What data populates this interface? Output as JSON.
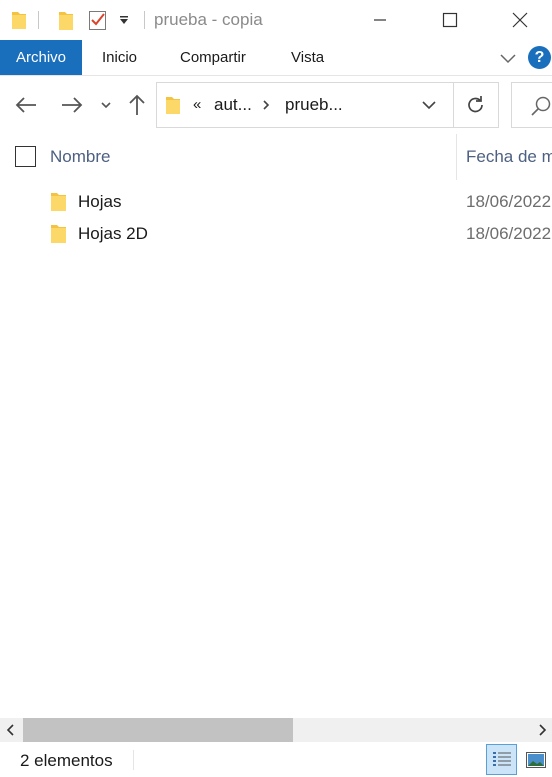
{
  "window": {
    "title": "prueba - copia",
    "accent": "#1a6fbd"
  },
  "quick_access": {
    "icons": [
      "folder-icon",
      "new-folder-icon",
      "properties-icon",
      "customize-dropdown-icon"
    ]
  },
  "window_controls": [
    "minimize-icon",
    "maximize-icon",
    "close-icon"
  ],
  "ribbon": {
    "tabs": [
      {
        "label": "Archivo",
        "active": true
      },
      {
        "label": "Inicio"
      },
      {
        "label": "Compartir"
      },
      {
        "label": "Vista"
      }
    ],
    "help_label": "?"
  },
  "navigation": {
    "buttons": [
      "back-arrow-icon",
      "forward-arrow-icon",
      "recent-locations-chevron-icon",
      "up-arrow-icon"
    ]
  },
  "address": {
    "overflow_marker": "«",
    "segments": [
      "aut...",
      "prueb..."
    ]
  },
  "columns": {
    "name": "Nombre",
    "date": "Fecha de m"
  },
  "files": [
    {
      "name": "Hojas",
      "date": "18/06/2022"
    },
    {
      "name": "Hojas 2D",
      "date": "18/06/2022"
    }
  ],
  "status": {
    "count_text": "2 elementos"
  }
}
